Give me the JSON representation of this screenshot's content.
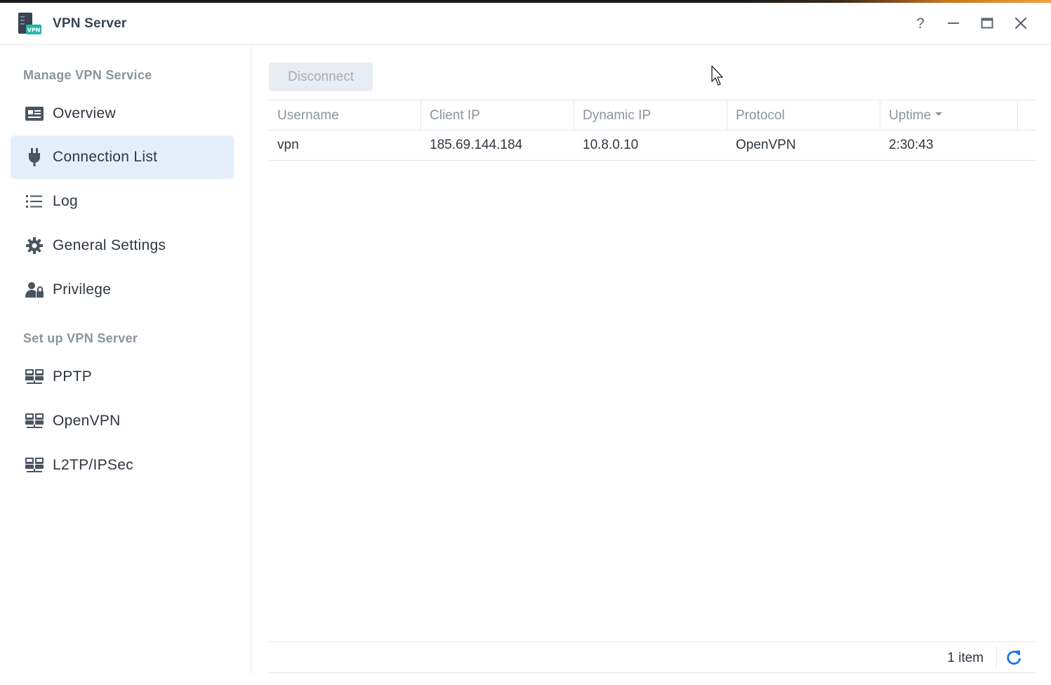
{
  "window": {
    "title": "VPN Server",
    "help_icon": "help-icon",
    "minimize_icon": "minimize-icon",
    "maximize_icon": "maximize-icon",
    "close_icon": "close-icon"
  },
  "sidebar": {
    "section_manage": "Manage VPN Service",
    "section_setup": "Set up VPN Server",
    "manage_items": [
      {
        "label": "Overview",
        "icon": "overview-card-icon"
      },
      {
        "label": "Connection List",
        "icon": "plug-icon",
        "active": true
      },
      {
        "label": "Log",
        "icon": "list-icon"
      },
      {
        "label": "General Settings",
        "icon": "gear-icon"
      },
      {
        "label": "Privilege",
        "icon": "user-lock-icon"
      }
    ],
    "setup_items": [
      {
        "label": "PPTP",
        "icon": "network-icon"
      },
      {
        "label": "OpenVPN",
        "icon": "network-icon"
      },
      {
        "label": "L2TP/IPSec",
        "icon": "network-icon"
      }
    ]
  },
  "toolbar": {
    "disconnect_label": "Disconnect"
  },
  "table": {
    "columns": [
      "Username",
      "Client IP",
      "Dynamic IP",
      "Protocol",
      "Uptime"
    ],
    "sorted_column": "Uptime",
    "rows": [
      [
        "vpn",
        "185.69.144.184",
        "10.8.0.10",
        "OpenVPN",
        "2:30:43"
      ]
    ]
  },
  "footer": {
    "item_count": "1 item",
    "refresh_icon": "refresh-icon"
  },
  "colors": {
    "accent": "#1a73e8",
    "active_bg": "#e4eefb",
    "muted_text": "#8a949e"
  }
}
